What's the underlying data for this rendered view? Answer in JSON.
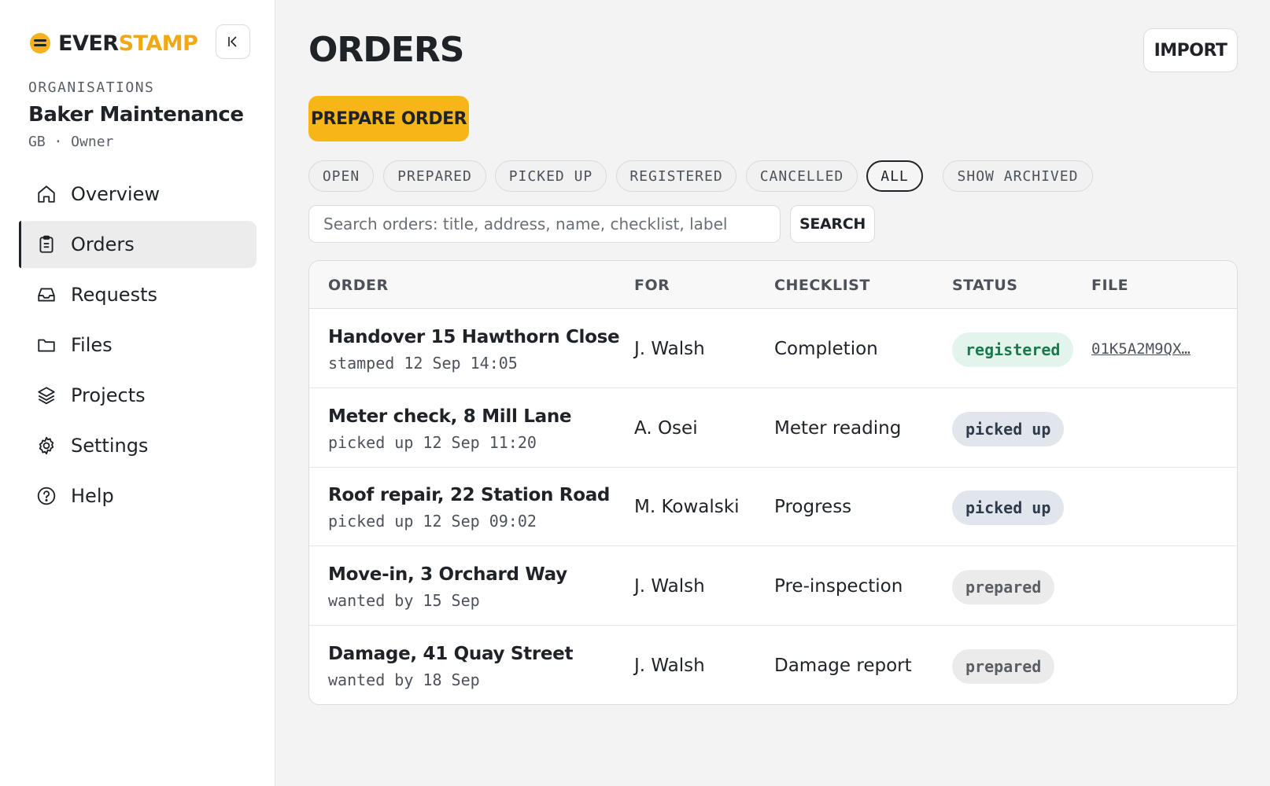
{
  "brand": {
    "name_part1": "EVER",
    "name_part2": "STAMP",
    "accent": "#f8b517"
  },
  "sidebar": {
    "org_label": "ORGANISATIONS",
    "org_name": "Baker Maintenance",
    "org_meta": "GB · Owner",
    "items": [
      {
        "label": "Overview",
        "icon": "home-icon",
        "active": false
      },
      {
        "label": "Orders",
        "icon": "clipboard-icon",
        "active": true
      },
      {
        "label": "Requests",
        "icon": "inbox-icon",
        "active": false
      },
      {
        "label": "Files",
        "icon": "folder-icon",
        "active": false
      },
      {
        "label": "Projects",
        "icon": "layers-icon",
        "active": false
      },
      {
        "label": "Settings",
        "icon": "gear-icon",
        "active": false
      },
      {
        "label": "Help",
        "icon": "help-circle-icon",
        "active": false
      }
    ]
  },
  "header": {
    "title": "ORDERS",
    "import_label": "IMPORT",
    "prepare_label": "PREPARE ORDER"
  },
  "filters": [
    {
      "label": "OPEN",
      "selected": false
    },
    {
      "label": "PREPARED",
      "selected": false
    },
    {
      "label": "PICKED UP",
      "selected": false
    },
    {
      "label": "REGISTERED",
      "selected": false
    },
    {
      "label": "CANCELLED",
      "selected": false
    },
    {
      "label": "ALL",
      "selected": true
    },
    {
      "label": "SHOW ARCHIVED",
      "selected": false
    }
  ],
  "search": {
    "placeholder": "Search orders: title, address, name, checklist, label",
    "value": "",
    "button_label": "SEARCH"
  },
  "table": {
    "columns": [
      "ORDER",
      "FOR",
      "CHECKLIST",
      "STATUS",
      "FILE"
    ],
    "rows": [
      {
        "title": "Handover 15 Hawthorn Close",
        "sub": "stamped 12 Sep 14:05",
        "for": "J. Walsh",
        "checklist": "Completion",
        "status": "registered",
        "file": "01K5A2M9QX…"
      },
      {
        "title": "Meter check, 8 Mill Lane",
        "sub": "picked up 12 Sep 11:20",
        "for": "A. Osei",
        "checklist": "Meter reading",
        "status": "picked up",
        "file": ""
      },
      {
        "title": "Roof repair, 22 Station Road",
        "sub": "picked up 12 Sep 09:02",
        "for": "M. Kowalski",
        "checklist": "Progress",
        "status": "picked up",
        "file": ""
      },
      {
        "title": "Move-in, 3 Orchard Way",
        "sub": "wanted by 15 Sep",
        "for": "J. Walsh",
        "checklist": "Pre-inspection",
        "status": "prepared",
        "file": ""
      },
      {
        "title": "Damage, 41 Quay Street",
        "sub": "wanted by 18 Sep",
        "for": "J. Walsh",
        "checklist": "Damage report",
        "status": "prepared",
        "file": ""
      }
    ]
  },
  "colors": {
    "registered_bg": "#e3f4ec",
    "registered_text": "#1a7a4c",
    "picked_bg": "#e1e6ec",
    "prepared_bg": "#ebebeb"
  }
}
